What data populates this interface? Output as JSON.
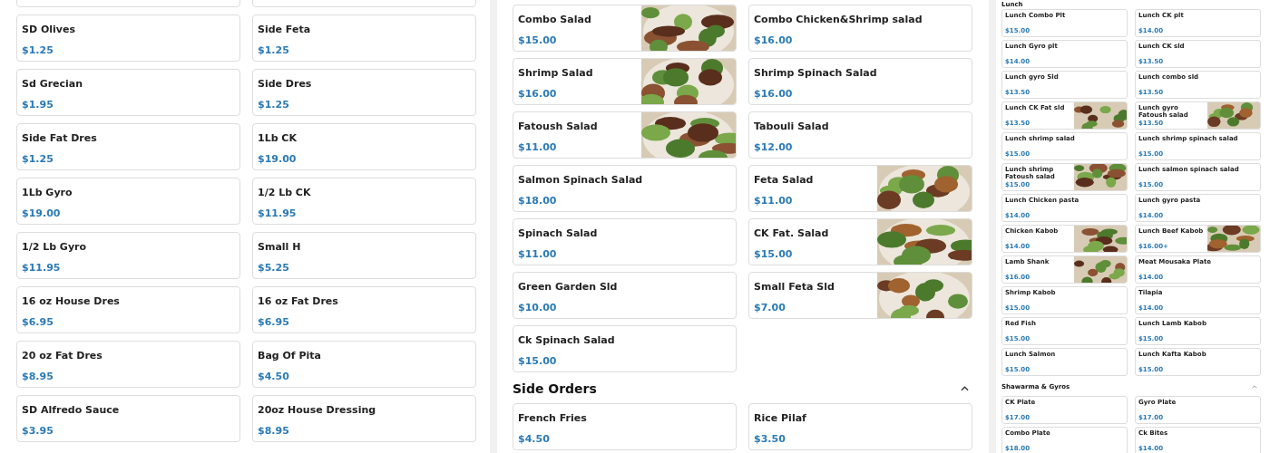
{
  "left": {
    "items": [
      {
        "name": "SD Olives",
        "price": "$1.25"
      },
      {
        "name": "Side Feta",
        "price": "$1.25"
      },
      {
        "name": "Sd Grecian",
        "price": "$1.95"
      },
      {
        "name": "Side Dres",
        "price": "$1.25"
      },
      {
        "name": "Side Fat Dres",
        "price": "$1.25"
      },
      {
        "name": "1Lb CK",
        "price": "$19.00"
      },
      {
        "name": "1Lb Gyro",
        "price": "$19.00"
      },
      {
        "name": "1/2 Lb CK",
        "price": "$11.95"
      },
      {
        "name": "1/2 Lb Gyro",
        "price": "$11.95"
      },
      {
        "name": "Small H",
        "price": "$5.25"
      },
      {
        "name": "16 oz House Dres",
        "price": "$6.95"
      },
      {
        "name": "16 oz Fat Dres",
        "price": "$6.95"
      },
      {
        "name": "20 oz Fat Dres",
        "price": "$8.95"
      },
      {
        "name": "Bag Of Pita",
        "price": "$4.50"
      },
      {
        "name": "SD Alfredo Sauce",
        "price": "$3.95"
      },
      {
        "name": "20oz House Dressing",
        "price": "$8.95"
      }
    ]
  },
  "middle": {
    "items": [
      {
        "name": "Combo Salad",
        "price": "$15.00",
        "kind": "picture"
      },
      {
        "name": "Combo Chicken&Shrimp salad",
        "price": "$16.00",
        "kind": "plain"
      },
      {
        "name": "Shrimp Salad",
        "price": "$16.00",
        "kind": "picture"
      },
      {
        "name": "Shrimp Spinach Salad",
        "price": "$16.00",
        "kind": "plain"
      },
      {
        "name": "Fatoush Salad",
        "price": "$11.00",
        "kind": "picture"
      },
      {
        "name": "Tabouli Salad",
        "price": "$12.00",
        "kind": "plain"
      },
      {
        "name": "Salmon Spinach Salad",
        "price": "$18.00",
        "kind": "plain"
      },
      {
        "name": "Feta Salad",
        "price": "$11.00",
        "kind": "picture"
      },
      {
        "name": "Spinach Salad",
        "price": "$11.00",
        "kind": "plain"
      },
      {
        "name": "CK Fat. Salad",
        "price": "$15.00",
        "kind": "picture"
      },
      {
        "name": "Green Garden Sld",
        "price": "$10.00",
        "kind": "plain"
      },
      {
        "name": "Small Feta Sld",
        "price": "$7.00",
        "kind": "picture"
      },
      {
        "name": "Ck Spinach Salad",
        "price": "$15.00",
        "kind": "plain"
      }
    ],
    "sections": [
      {
        "title": "Side Orders",
        "expanded": true,
        "items": [
          {
            "name": "French Fries",
            "price": "$4.50"
          },
          {
            "name": "Rice Pilaf",
            "price": "$3.50"
          }
        ]
      }
    ]
  },
  "right": {
    "sections": [
      {
        "title": "Lunch",
        "items": [
          {
            "name": "Lunch Combo Plt",
            "price": "$15.00",
            "kind": "plain"
          },
          {
            "name": "Lunch CK plt",
            "price": "$14.00",
            "kind": "plain"
          },
          {
            "name": "Lunch Gyro plt",
            "price": "$14.00",
            "kind": "plain"
          },
          {
            "name": "Lunch CK sld",
            "price": "$13.50",
            "kind": "plain"
          },
          {
            "name": "Lunch gyro Sld",
            "price": "$13.50",
            "kind": "plain"
          },
          {
            "name": "Lunch combo sld",
            "price": "$13.50",
            "kind": "plain"
          },
          {
            "name": "Lunch CK Fat sld",
            "price": "$13.50",
            "kind": "picture"
          },
          {
            "name": "Lunch gyro Fatoush salad",
            "price": "$13.50",
            "kind": "picture"
          },
          {
            "name": "Lunch shrimp salad",
            "price": "$15.00",
            "kind": "plain"
          },
          {
            "name": "Lunch shrimp spinach salad",
            "price": "$15.00",
            "kind": "plain"
          },
          {
            "name": "Lunch shrimp Fatoush salad",
            "price": "$15.00",
            "kind": "picture"
          },
          {
            "name": "Lunch salmon spinach salad",
            "price": "$15.00",
            "kind": "plain"
          },
          {
            "name": "Lunch Chicken pasta",
            "price": "$14.00",
            "kind": "plain"
          },
          {
            "name": "Lunch gyro pasta",
            "price": "$14.00",
            "kind": "plain"
          },
          {
            "name": "Chicken Kabob",
            "price": "$14.00",
            "kind": "picture"
          },
          {
            "name": "Lunch Beef Kabob",
            "price": "$16.00+",
            "kind": "picture"
          },
          {
            "name": "Lamb Shank",
            "price": "$16.00",
            "kind": "picture"
          },
          {
            "name": "Meat Mousaka Plate",
            "price": "$14.00",
            "kind": "plain"
          },
          {
            "name": "Shrimp Kabob",
            "price": "$15.00",
            "kind": "plain"
          },
          {
            "name": "Tilapia",
            "price": "$14.00",
            "kind": "plain"
          },
          {
            "name": "Red Fish",
            "price": "$15.00",
            "kind": "plain"
          },
          {
            "name": "Lunch Lamb Kabob",
            "price": "$15.00",
            "kind": "plain"
          },
          {
            "name": "Lunch Salmon",
            "price": "$15.00",
            "kind": "plain"
          },
          {
            "name": "Lunch Kafta Kabob",
            "price": "$15.00",
            "kind": "plain"
          }
        ]
      },
      {
        "title": "Shawarma & Gyros",
        "expanded": true,
        "items": [
          {
            "name": "CK Plate",
            "price": "$17.00",
            "kind": "plain"
          },
          {
            "name": "Gyro Plate",
            "price": "$17.00",
            "kind": "plain"
          },
          {
            "name": "Combo Plate",
            "price": "$18.00",
            "kind": "plain"
          },
          {
            "name": "Ck Bites",
            "price": "$14.00",
            "kind": "plain"
          }
        ]
      }
    ]
  }
}
